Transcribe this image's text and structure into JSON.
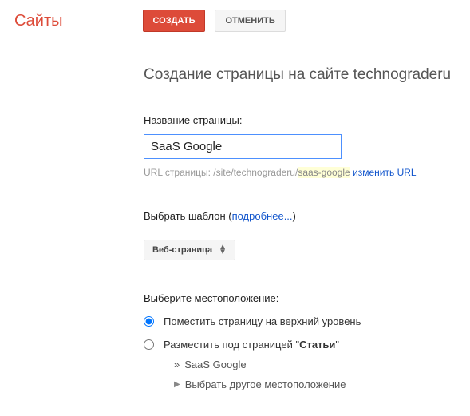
{
  "header": {
    "logo": "Сайты",
    "create_btn": "СОЗДАТЬ",
    "cancel_btn": "Отменить"
  },
  "page": {
    "title": "Создание страницы на сайте technograderu",
    "name_label": "Название страницы:",
    "name_value": "SaaS Google",
    "url_prefix": "URL страницы: /site/technograderu/",
    "url_slug": "saas-google",
    "url_change": "изменить URL"
  },
  "template": {
    "label": "Выбрать шаблон (",
    "more_link": "подробнее...",
    "label_close": ")",
    "selected": "Веб-страница"
  },
  "location": {
    "label": "Выберите местоположение:",
    "opt_top": "Поместить страницу на верхний уровень",
    "opt_under_prefix": "Разместить под страницей \"",
    "opt_under_page": "Статьи",
    "opt_under_suffix": "\"",
    "sub_current": "SaaS Google",
    "sub_other": "Выбрать другое местоположение"
  }
}
